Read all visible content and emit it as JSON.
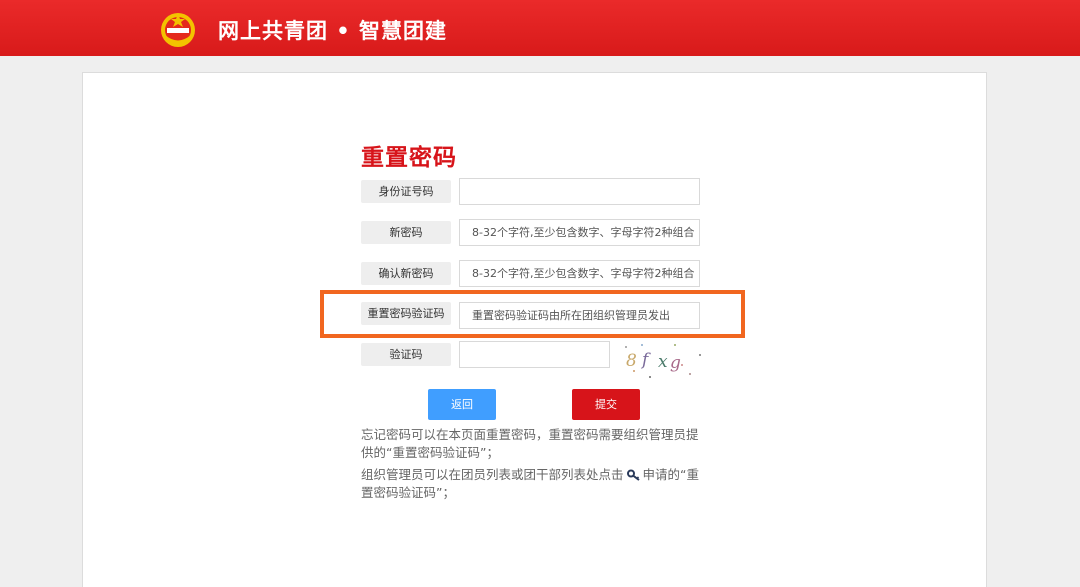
{
  "header": {
    "site_title": "网上共青团 • 智慧团建",
    "logo_icon": "communist-youth-league-emblem"
  },
  "form": {
    "title": "重置密码",
    "fields": [
      {
        "label": "身份证号码",
        "value": "",
        "placeholder": ""
      },
      {
        "label": "新密码",
        "value": "",
        "placeholder": "8-32个字符,至少包含数字、字母字符2种组合"
      },
      {
        "label": "确认新密码",
        "value": "",
        "placeholder": "8-32个字符,至少包含数字、字母字符2种组合"
      },
      {
        "label": "重置密码验证码",
        "value": "",
        "placeholder": "重置密码验证码由所在团组织管理员发出"
      },
      {
        "label": "验证码",
        "value": "",
        "placeholder": ""
      }
    ],
    "captcha_text": "8f xg",
    "back_label": "返回",
    "submit_label": "提交"
  },
  "notes": {
    "line1": "忘记密码可以在本页面重置密码，重置密码需要组织管理员提供的“重置密码验证码”；",
    "line2_before": "组织管理员可以在团员列表或团干部列表处点击",
    "line2_after": "申请的“重置密码验证码”；"
  },
  "colors": {
    "header_red": "#e02020",
    "title_red": "#d7141a",
    "back_blue": "#409eff",
    "highlight_orange": "#f1661f"
  }
}
